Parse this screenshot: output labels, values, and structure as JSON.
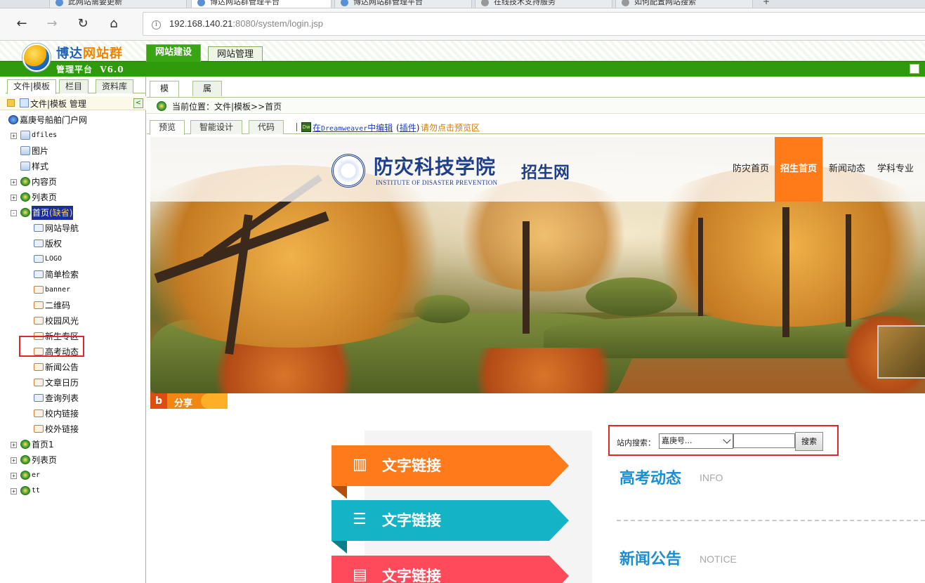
{
  "browser": {
    "tabs": [
      {
        "label": "此网站需要更新"
      },
      {
        "label": "博达网站群管理平台"
      },
      {
        "label": "博达网站群管理平台"
      },
      {
        "label": "在线技术支持服务"
      },
      {
        "label": "如何配置网站搜索"
      }
    ],
    "new_tab": "+",
    "url_host": "192.168.140.21",
    "url_rest": ":8080/system/login.jsp",
    "nav": {
      "back": "←",
      "forward": "→",
      "refresh": "↻",
      "home": "⌂",
      "info": "i"
    }
  },
  "app": {
    "logo_title_a": "博达",
    "logo_title_b": "网站群",
    "logo_sub": "管理平台  V6.0",
    "tabs": [
      "网站建设",
      "网站管理"
    ]
  },
  "left": {
    "tabs": [
      "文件|模板",
      "栏目",
      "资料库"
    ],
    "header": "文件|模板 管理",
    "collapse": "<",
    "tree": [
      {
        "label": "嘉庚号船舶门户网",
        "level": 0,
        "icon": "site-icon"
      },
      {
        "label": "dfiles",
        "level": 1,
        "icon": "folder-icon",
        "exp": "+"
      },
      {
        "label": "图片",
        "level": 1,
        "icon": "folder-icon",
        "exp": ""
      },
      {
        "label": "样式",
        "level": 1,
        "icon": "folder-icon",
        "exp": ""
      },
      {
        "label": "内容页",
        "level": 1,
        "icon": "globe-icon",
        "exp": "+"
      },
      {
        "label": "列表页",
        "level": 1,
        "icon": "globe-icon",
        "exp": "+"
      },
      {
        "label": "首页",
        "level": 1,
        "icon": "globe-icon",
        "exp": "-",
        "badge": "(缺省)"
      },
      {
        "label": "网站导航",
        "level": 2,
        "icon": "component-icon"
      },
      {
        "label": "版权",
        "level": 2,
        "icon": "component-icon"
      },
      {
        "label": "LOGO",
        "level": 2,
        "icon": "component-icon"
      },
      {
        "label": "简单检索",
        "level": 2,
        "icon": "component-icon"
      },
      {
        "label": "banner",
        "level": 2,
        "icon": "component-orange-icon"
      },
      {
        "label": "二维码",
        "level": 2,
        "icon": "component-orange-icon"
      },
      {
        "label": "校园风光",
        "level": 2,
        "icon": "component-orange-icon"
      },
      {
        "label": "新生专区",
        "level": 2,
        "icon": "component-orange-icon"
      },
      {
        "label": "高考动态",
        "level": 2,
        "icon": "component-orange-icon"
      },
      {
        "label": "新闻公告",
        "level": 2,
        "icon": "component-orange-icon"
      },
      {
        "label": "文章日历",
        "level": 2,
        "icon": "component-orange-icon"
      },
      {
        "label": "查询列表",
        "level": 2,
        "icon": "component-icon"
      },
      {
        "label": "校内链接",
        "level": 2,
        "icon": "component-orange-icon"
      },
      {
        "label": "校外链接",
        "level": 2,
        "icon": "component-orange-icon"
      },
      {
        "label": "首页1",
        "level": 1,
        "icon": "globe-icon",
        "exp": "+"
      },
      {
        "label": "列表页",
        "level": 1,
        "icon": "globe-icon",
        "exp": "+"
      },
      {
        "label": "er",
        "level": 1,
        "icon": "globe-icon",
        "exp": "+"
      },
      {
        "label": "tt",
        "level": 1,
        "icon": "globe-icon",
        "exp": "+"
      }
    ]
  },
  "work": {
    "tabs": [
      "模板",
      "属性"
    ],
    "breadcrumb": "当前位置：文件|模板>>首页",
    "subtabs": [
      "预览",
      "智能设计",
      "代码"
    ],
    "dw_icon": "Dw",
    "dw_prefix": "在",
    "dw_app": "Dreamweaver",
    "dw_suffix": "中编辑",
    "dw_plugin_open": "(",
    "dw_plugin": "插件",
    "dw_plugin_close": ")",
    "dw_note": "请勿点击预览区"
  },
  "preview": {
    "site_name": "防灾科技学院",
    "site_name_en": "INSTITUTE OF DISASTER PREVENTION",
    "site_recruit": "招生网",
    "nav": [
      "防灾首页",
      "招生首页",
      "新闻动态",
      "学科专业"
    ],
    "share_icon": "b",
    "share": "分享",
    "ribbons": [
      {
        "label": "文字链接",
        "color": "#ff7a1a",
        "fold": "#b24f0d",
        "icon": "chart-icon",
        "glyph": "📊"
      },
      {
        "label": "文字链接",
        "color": "#14b4c6",
        "fold": "#0c7f8c",
        "icon": "list-icon",
        "glyph": "☰"
      },
      {
        "label": "文字链接",
        "color": "#ff4a5a",
        "fold": "#b8303c",
        "icon": "document-icon",
        "glyph": "▤"
      }
    ],
    "search": {
      "label": "站内搜索：",
      "selected": "嘉庚号...",
      "input_value": "",
      "button": "搜索"
    },
    "sections": [
      {
        "title": "高考动态",
        "en": "INFO"
      },
      {
        "title": "新闻公告",
        "en": "NOTICE"
      }
    ]
  }
}
